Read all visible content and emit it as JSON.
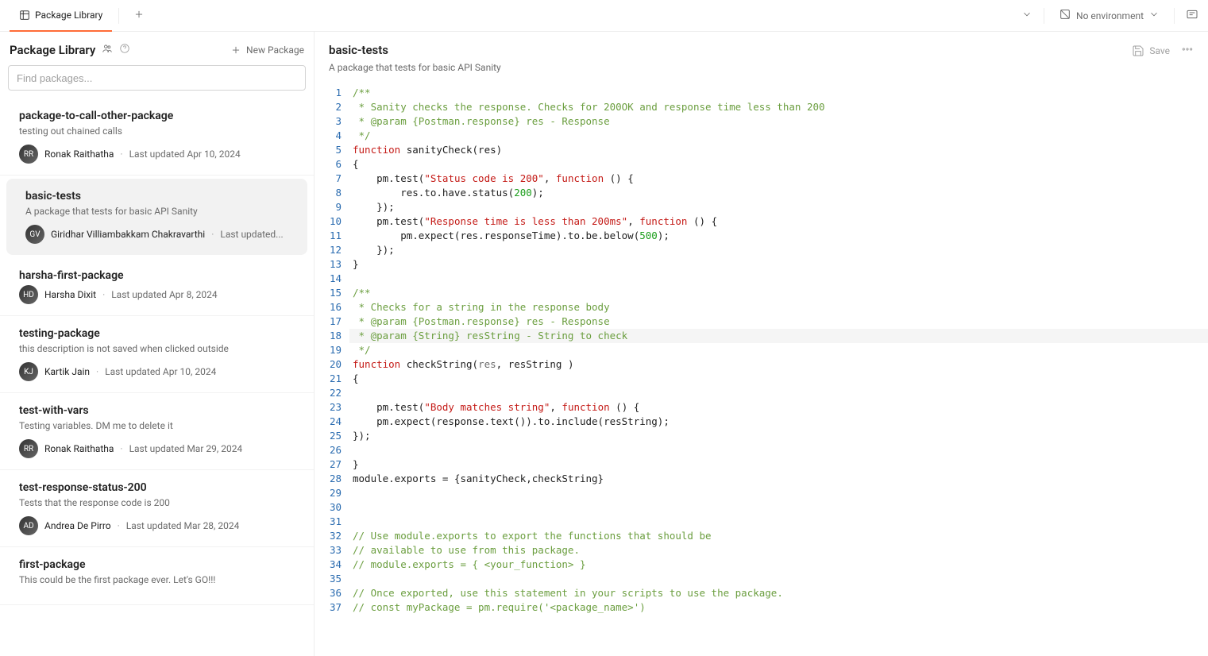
{
  "topbar": {
    "tab_label": "Package Library",
    "env_label": "No environment"
  },
  "sidebar": {
    "title": "Package Library",
    "new_package_label": "New Package",
    "search_placeholder": "Find packages...",
    "packages": [
      {
        "name": "package-to-call-other-package",
        "desc": "testing out chained calls",
        "author": "Ronak Raithatha",
        "updated": "Last updated Apr 10, 2024"
      },
      {
        "name": "basic-tests",
        "desc": "A package that tests for basic API Sanity",
        "author": "Giridhar Villiambakkam Chakravarthi",
        "updated": "Last updated..."
      },
      {
        "name": "harsha-first-package",
        "desc": "",
        "author": "Harsha Dixit",
        "updated": "Last updated Apr 8, 2024"
      },
      {
        "name": "testing-package",
        "desc": "this description is not saved when clicked outside",
        "author": "Kartik Jain",
        "updated": "Last updated Apr 10, 2024"
      },
      {
        "name": "test-with-vars",
        "desc": "Testing variables. DM me to delete it",
        "author": "Ronak Raithatha",
        "updated": "Last updated Mar 29, 2024"
      },
      {
        "name": "test-response-status-200",
        "desc": "Tests that the response code is 200",
        "author": "Andrea De Pirro",
        "updated": "Last updated Mar 28, 2024"
      },
      {
        "name": "first-package",
        "desc": "This could be the first package ever. Let's GO!!!",
        "author": "",
        "updated": ""
      }
    ]
  },
  "content": {
    "title": "basic-tests",
    "desc": "A package that tests for basic API Sanity",
    "save_label": "Save"
  },
  "code": {
    "lines": [
      [
        {
          "c": "comment",
          "t": "/**"
        }
      ],
      [
        {
          "c": "comment",
          "t": " * Sanity checks the response. Checks for 200OK and response time less than 200"
        }
      ],
      [
        {
          "c": "comment",
          "t": " * @param {Postman.response} res - Response"
        }
      ],
      [
        {
          "c": "comment",
          "t": " */"
        }
      ],
      [
        {
          "c": "keyword",
          "t": "function"
        },
        {
          "c": "plain",
          "t": " sanityCheck(res)"
        }
      ],
      [
        {
          "c": "plain",
          "t": "{"
        }
      ],
      [
        {
          "c": "plain",
          "t": "    pm.test("
        },
        {
          "c": "string",
          "t": "\"Status code is 200\""
        },
        {
          "c": "plain",
          "t": ", "
        },
        {
          "c": "keyword",
          "t": "function"
        },
        {
          "c": "plain",
          "t": " () {"
        }
      ],
      [
        {
          "c": "plain",
          "t": "        res.to.have.status("
        },
        {
          "c": "number",
          "t": "200"
        },
        {
          "c": "plain",
          "t": ");"
        }
      ],
      [
        {
          "c": "plain",
          "t": "    });"
        }
      ],
      [
        {
          "c": "plain",
          "t": "    pm.test("
        },
        {
          "c": "string",
          "t": "\"Response time is less than 200ms\""
        },
        {
          "c": "plain",
          "t": ", "
        },
        {
          "c": "keyword",
          "t": "function"
        },
        {
          "c": "plain",
          "t": " () {"
        }
      ],
      [
        {
          "c": "plain",
          "t": "        pm.expect(res.responseTime).to.be.below("
        },
        {
          "c": "number",
          "t": "500"
        },
        {
          "c": "plain",
          "t": ");"
        }
      ],
      [
        {
          "c": "plain",
          "t": "    });"
        }
      ],
      [
        {
          "c": "plain",
          "t": "}"
        }
      ],
      [],
      [
        {
          "c": "comment",
          "t": "/**"
        }
      ],
      [
        {
          "c": "comment",
          "t": " * Checks for a string in the response body"
        }
      ],
      [
        {
          "c": "comment",
          "t": " * @param {Postman.response} res - Response"
        }
      ],
      [
        {
          "c": "comment",
          "t": " * @param {String} resString - String to check"
        }
      ],
      [
        {
          "c": "comment",
          "t": " */"
        }
      ],
      [
        {
          "c": "keyword",
          "t": "function"
        },
        {
          "c": "plain",
          "t": " checkString("
        },
        {
          "c": "param",
          "t": "res"
        },
        {
          "c": "plain",
          "t": ", resString )"
        }
      ],
      [
        {
          "c": "plain",
          "t": "{"
        }
      ],
      [],
      [
        {
          "c": "plain",
          "t": "    pm.test("
        },
        {
          "c": "string",
          "t": "\"Body matches string\""
        },
        {
          "c": "plain",
          "t": ", "
        },
        {
          "c": "keyword",
          "t": "function"
        },
        {
          "c": "plain",
          "t": " () {"
        }
      ],
      [
        {
          "c": "plain",
          "t": "    pm.expect(response.text()).to.include(resString);"
        }
      ],
      [
        {
          "c": "plain",
          "t": "});"
        }
      ],
      [],
      [
        {
          "c": "plain",
          "t": "}"
        }
      ],
      [
        {
          "c": "plain",
          "t": "module.exports = {sanityCheck,checkString}"
        }
      ],
      [],
      [],
      [],
      [
        {
          "c": "comment",
          "t": "// Use module.exports to export the functions that should be"
        }
      ],
      [
        {
          "c": "comment",
          "t": "// available to use from this package."
        }
      ],
      [
        {
          "c": "comment",
          "t": "// module.exports = { <your_function> }"
        }
      ],
      [],
      [
        {
          "c": "comment",
          "t": "// Once exported, use this statement in your scripts to use the package."
        }
      ],
      [
        {
          "c": "comment",
          "t": "// const myPackage = pm.require('<package_name>')"
        }
      ]
    ],
    "highlight_line": 18
  }
}
